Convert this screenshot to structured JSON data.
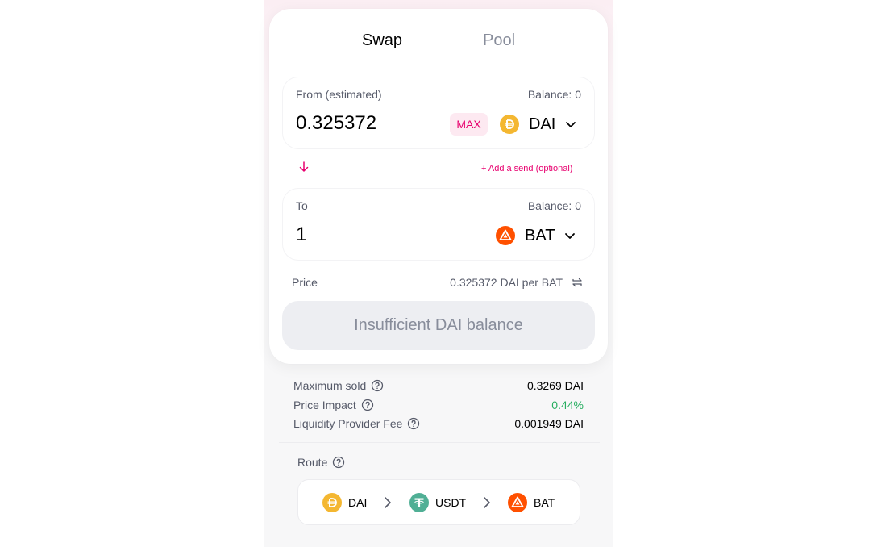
{
  "tabs": {
    "swap": "Swap",
    "pool": "Pool"
  },
  "from": {
    "label": "From (estimated)",
    "balance": "Balance: 0",
    "amount": "0.325372",
    "max_label": "MAX",
    "token": "DAI"
  },
  "add_send_label": "+ Add a send (optional)",
  "to": {
    "label": "To",
    "balance": "Balance: 0",
    "amount": "1",
    "token": "BAT"
  },
  "price": {
    "label": "Price",
    "value": "0.325372 DAI per BAT"
  },
  "action_button": "Insufficient DAI balance",
  "details": {
    "maximum_sold": {
      "label": "Maximum sold",
      "value": "0.3269 DAI"
    },
    "price_impact": {
      "label": "Price Impact",
      "value": "0.44%"
    },
    "lp_fee": {
      "label": "Liquidity Provider Fee",
      "value": "0.001949 DAI"
    }
  },
  "route": {
    "label": "Route",
    "tokens": [
      "DAI",
      "USDT",
      "BAT"
    ]
  },
  "colors": {
    "accent": "#e8006f",
    "dai": "#f4b731",
    "bat": "#ff5000",
    "usdt": "#50af95",
    "positive": "#27ae60"
  },
  "icons": {
    "dai": "dai-token-icon",
    "bat": "bat-token-icon",
    "usdt": "usdt-token-icon"
  }
}
